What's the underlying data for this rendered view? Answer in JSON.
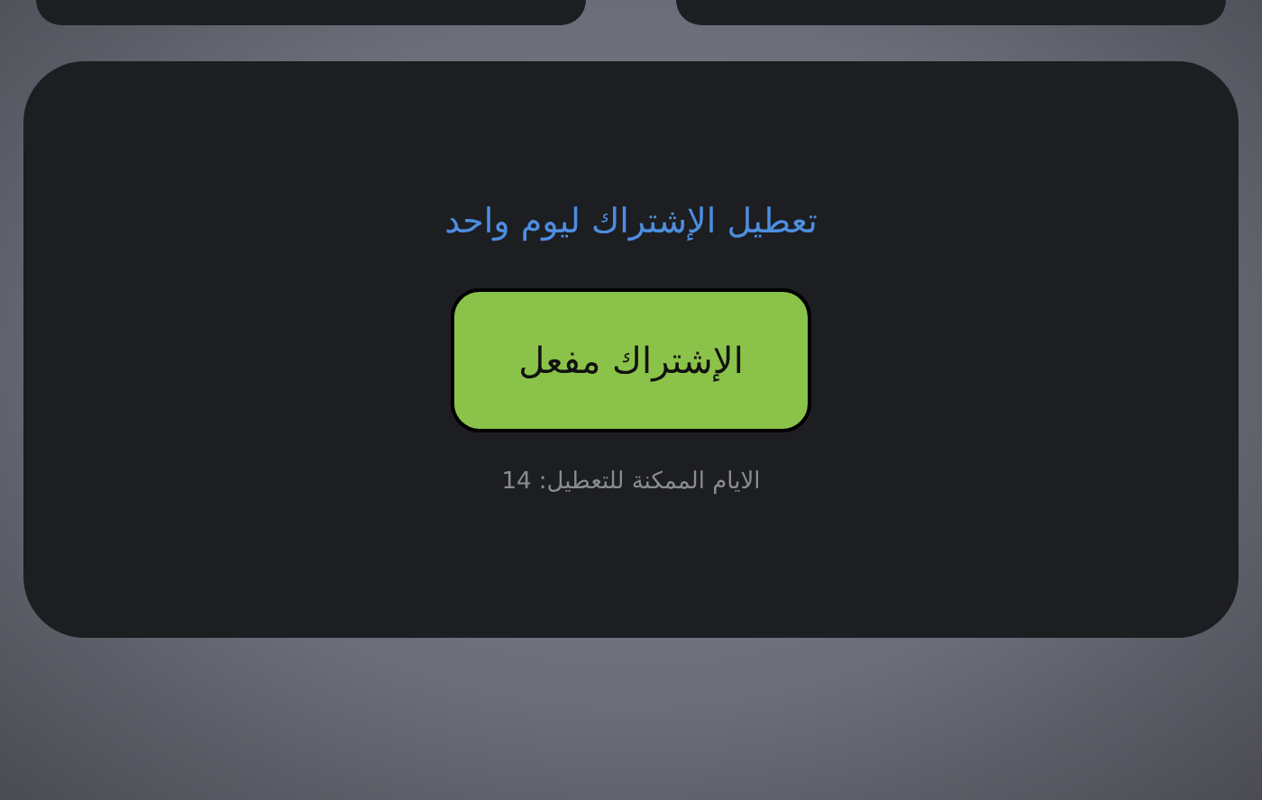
{
  "card": {
    "title": "تعطيل الإشتراك ليوم واحد",
    "toggle_button": {
      "label": "الإشتراك مفعل",
      "on": true
    },
    "remaining": "الايام الممكنة للتعطيل: 14"
  }
}
